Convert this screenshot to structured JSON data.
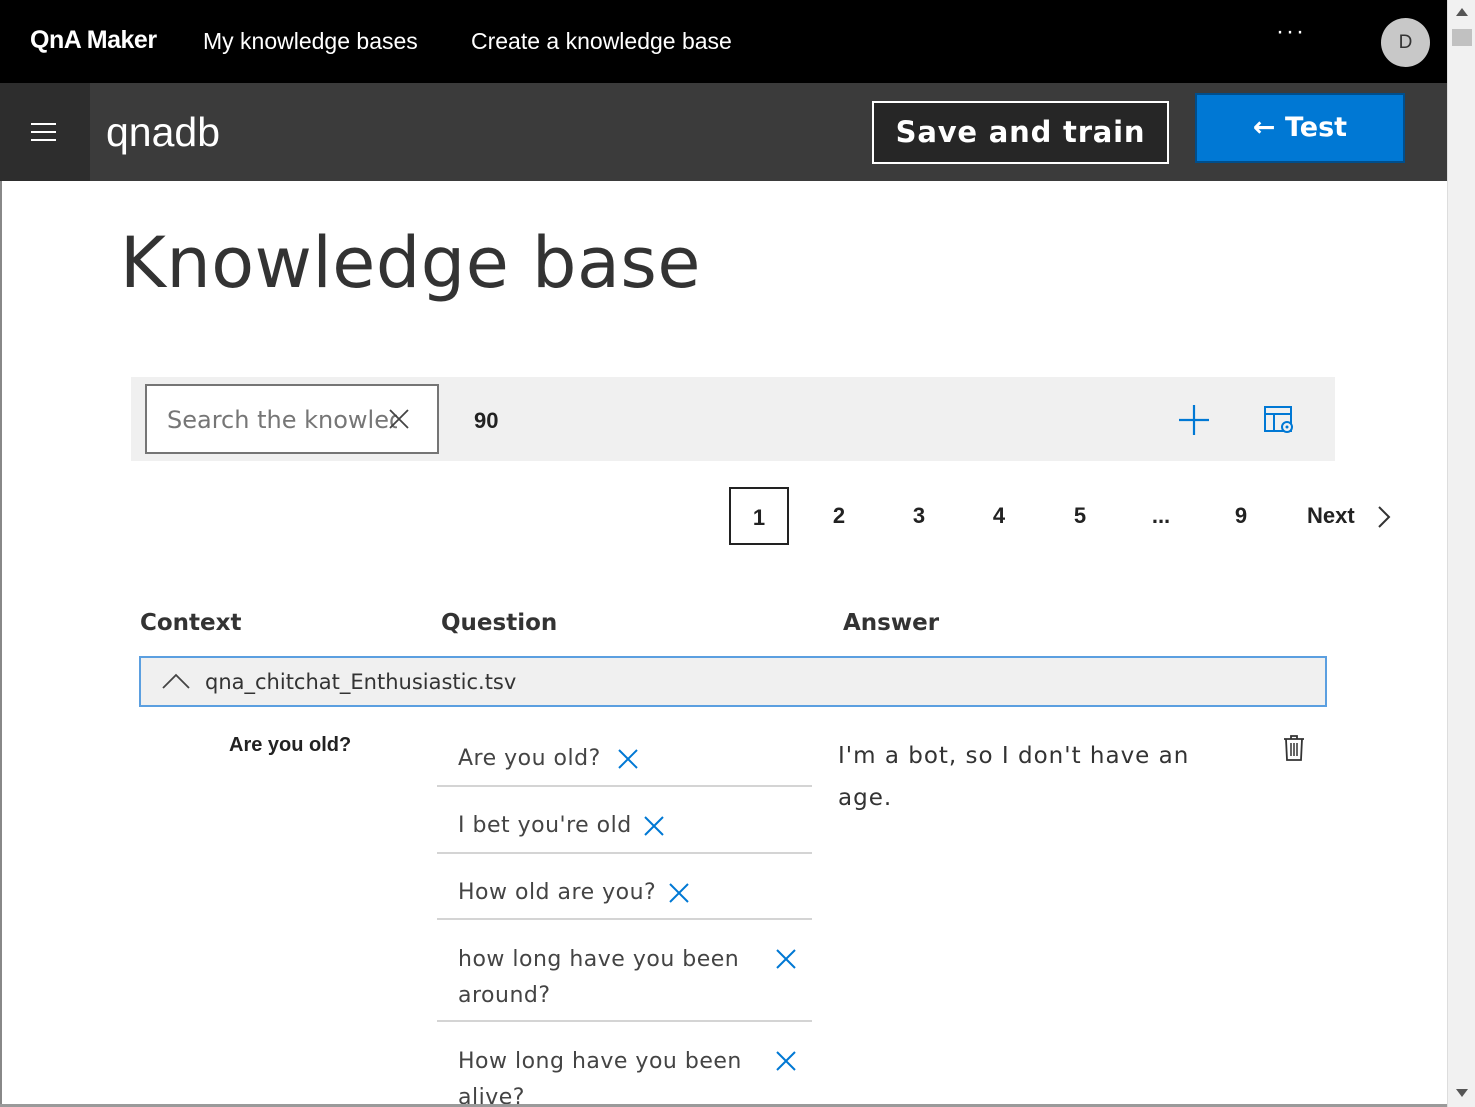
{
  "topbar": {
    "brand": "QnA Maker",
    "nav": [
      "My knowledge bases",
      "Create a knowledge base"
    ],
    "more": "···",
    "avatar_initial": "D"
  },
  "subbar": {
    "kb_name": "qnadb",
    "save_label": "Save and train",
    "test_label": "← Test"
  },
  "main": {
    "title": "Knowledge base",
    "search_placeholder": "Search the knowledge base",
    "count": "90",
    "pagination": {
      "pages": [
        "1",
        "2",
        "3",
        "4",
        "5",
        "...",
        "9"
      ],
      "current": "1",
      "next_label": "Next"
    },
    "columns": [
      "Context",
      "Question",
      "Answer"
    ],
    "group": {
      "label": "qna_chitchat_Enthusiastic.tsv",
      "expanded": true
    },
    "qna": {
      "context_question": "Are you old?",
      "questions": [
        "Are you old?",
        "I bet you're old",
        "How old are you?",
        "how long have you been around?",
        "How long have you been alive?"
      ],
      "answer": "I'm a bot, so I don't have an age."
    }
  },
  "colors": {
    "topbar_bg": "#000000",
    "subbar_bg": "#3b3b3b",
    "accent": "#0078d4",
    "group_border": "#5b9fe0"
  },
  "icons": {
    "menu": "hamburger-icon",
    "search_clear": "close-icon",
    "add": "plus-icon",
    "view_options": "table-settings-icon",
    "next": "chevron-right-icon",
    "collapse": "chevron-up-icon",
    "remove_question": "close-icon",
    "delete": "trash-icon"
  }
}
